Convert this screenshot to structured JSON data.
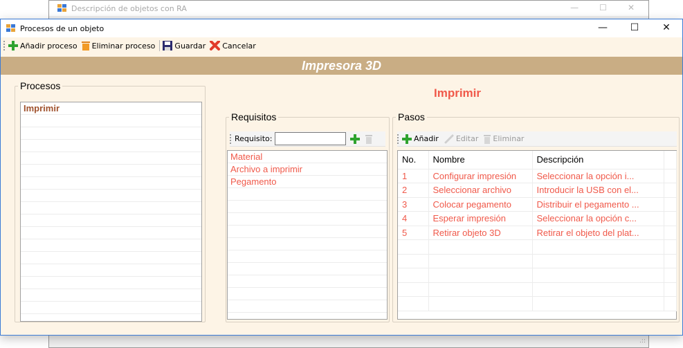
{
  "background_window": {
    "title": "Descripción de objetos con RA"
  },
  "window": {
    "title": "Procesos de un objeto"
  },
  "toolbar": {
    "add_label": "Añadir proceso",
    "delete_label": "Eliminar proceso",
    "save_label": "Guardar",
    "cancel_label": "Cancelar"
  },
  "banner": {
    "title": "Impresora 3D"
  },
  "procesos": {
    "legend": "Procesos",
    "items": [
      "Imprimir"
    ]
  },
  "selected_process": {
    "title": "Imprimir"
  },
  "requisitos": {
    "legend": "Requisitos",
    "input_label": "Requisito:",
    "input_value": "",
    "items": [
      "Material",
      "Archivo a imprimir",
      "Pegamento"
    ]
  },
  "pasos": {
    "legend": "Pasos",
    "toolbar": {
      "add_label": "Añadir",
      "edit_label": "Editar",
      "delete_label": "Eliminar"
    },
    "columns": [
      "No.",
      "Nombre",
      "Descripción"
    ],
    "rows": [
      {
        "no": "1",
        "nombre": "Configurar impresión",
        "descripcion": "Seleccionar la opción i..."
      },
      {
        "no": "2",
        "nombre": "Seleccionar archivo",
        "descripcion": "Introducir la USB con el..."
      },
      {
        "no": "3",
        "nombre": "Colocar pegamento",
        "descripcion": "Distribuir el pegamento ..."
      },
      {
        "no": "4",
        "nombre": "Esperar impresión",
        "descripcion": "Seleccionar la opción c..."
      },
      {
        "no": "5",
        "nombre": "Retirar objeto 3D",
        "descripcion": "Retirar el objeto del plat..."
      }
    ]
  },
  "colors": {
    "accent": "#f0594a",
    "banner": "#c9ad84",
    "window_bg": "#fdf4e6",
    "add_green": "#2fa32f",
    "cancel_red": "#e23b2a"
  },
  "icons": {
    "add": "plus-icon",
    "delete": "trash-icon",
    "save": "floppy-icon",
    "cancel": "cross-icon",
    "edit": "pencil-icon"
  }
}
